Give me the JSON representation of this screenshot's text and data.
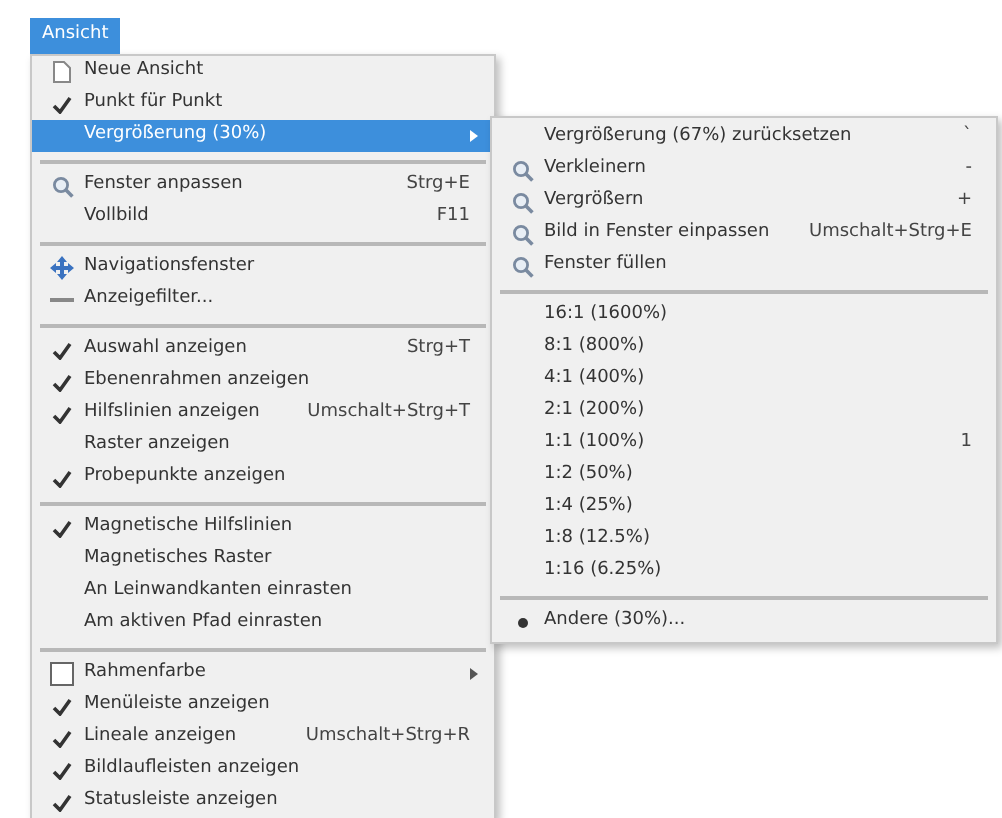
{
  "menu_bar": [
    {
      "label": "Ansicht",
      "selected": true
    }
  ],
  "menu": {
    "groups": [
      [
        {
          "kind": "page",
          "label": "Neue Ansicht",
          "selected": false
        },
        {
          "kind": "check",
          "label": "Punkt für Punkt",
          "checked": true,
          "selected": false
        },
        {
          "kind": "plain",
          "label": "Vergrößerung (30%)",
          "submenu": true,
          "selected": true
        }
      ],
      [
        {
          "kind": "zoom",
          "label": "Fenster anpassen",
          "shortcut": "Strg+E",
          "selected": false
        },
        {
          "kind": "plain",
          "label": "Vollbild",
          "shortcut": "F11",
          "selected": false
        }
      ],
      [
        {
          "kind": "navigate",
          "label": "Navigationsfenster",
          "selected": false
        },
        {
          "kind": "filter",
          "label": "Anzeigefilter...",
          "selected": false
        }
      ],
      [
        {
          "kind": "check",
          "label": "Auswahl anzeigen",
          "shortcut": "Strg+T",
          "checked": true,
          "selected": false
        },
        {
          "kind": "check",
          "label": "Ebenenrahmen anzeigen",
          "checked": true,
          "selected": false
        },
        {
          "kind": "check",
          "label": "Hilfslinien anzeigen",
          "shortcut": "Umschalt+Strg+T",
          "checked": true,
          "selected": false
        },
        {
          "kind": "check",
          "label": "Raster anzeigen",
          "checked": false,
          "selected": false
        },
        {
          "kind": "check",
          "label": "Probepunkte anzeigen",
          "checked": true,
          "selected": false
        }
      ],
      [
        {
          "kind": "check",
          "label": "Magnetische Hilfslinien",
          "checked": true,
          "selected": false
        },
        {
          "kind": "check",
          "label": "Magnetisches Raster",
          "checked": false,
          "selected": false
        },
        {
          "kind": "check",
          "label": "An Leinwandkanten einrasten",
          "checked": false,
          "selected": false
        },
        {
          "kind": "check",
          "label": "Am aktiven Pfad einrasten",
          "checked": false,
          "selected": false
        }
      ],
      [
        {
          "kind": "swatch",
          "label": "Rahmenfarbe",
          "submenu": true,
          "selected": false
        },
        {
          "kind": "check",
          "label": "Menüleiste anzeigen",
          "checked": true,
          "selected": false
        },
        {
          "kind": "check",
          "label": "Lineale anzeigen",
          "shortcut": "Umschalt+Strg+R",
          "checked": true,
          "selected": false
        },
        {
          "kind": "check",
          "label": "Bildlaufleisten anzeigen",
          "checked": true,
          "selected": false
        },
        {
          "kind": "check",
          "label": "Statusleiste anzeigen",
          "checked": true,
          "selected": false
        }
      ]
    ]
  },
  "submenu": {
    "groups": [
      [
        {
          "kind": "plain",
          "label": "Vergrößerung (67%) zurücksetzen",
          "shortcut": "`"
        },
        {
          "kind": "zoom",
          "label": "Verkleinern",
          "shortcut": "-"
        },
        {
          "kind": "zoom",
          "label": "Vergrößern",
          "shortcut": "+"
        },
        {
          "kind": "zoom",
          "label": "Bild in Fenster einpassen",
          "shortcut": "Umschalt+Strg+E"
        },
        {
          "kind": "zoom",
          "label": "Fenster füllen"
        }
      ],
      [
        {
          "kind": "radio",
          "label": "16:1 (1600%)",
          "selected": false
        },
        {
          "kind": "radio",
          "label": "8:1 (800%)",
          "selected": false
        },
        {
          "kind": "radio",
          "label": "4:1 (400%)",
          "selected": false
        },
        {
          "kind": "radio",
          "label": "2:1 (200%)",
          "selected": false
        },
        {
          "kind": "radio",
          "label": "1:1 (100%)",
          "shortcut": "1",
          "selected": false
        },
        {
          "kind": "radio",
          "label": "1:2 (50%)",
          "selected": false
        },
        {
          "kind": "radio",
          "label": "1:4 (25%)",
          "selected": false
        },
        {
          "kind": "radio",
          "label": "1:8 (12.5%)",
          "selected": false
        },
        {
          "kind": "radio",
          "label": "1:16 (6.25%)",
          "selected": false
        }
      ],
      [
        {
          "kind": "radio",
          "label": "Andere (30%)...",
          "selected": true
        }
      ]
    ]
  }
}
